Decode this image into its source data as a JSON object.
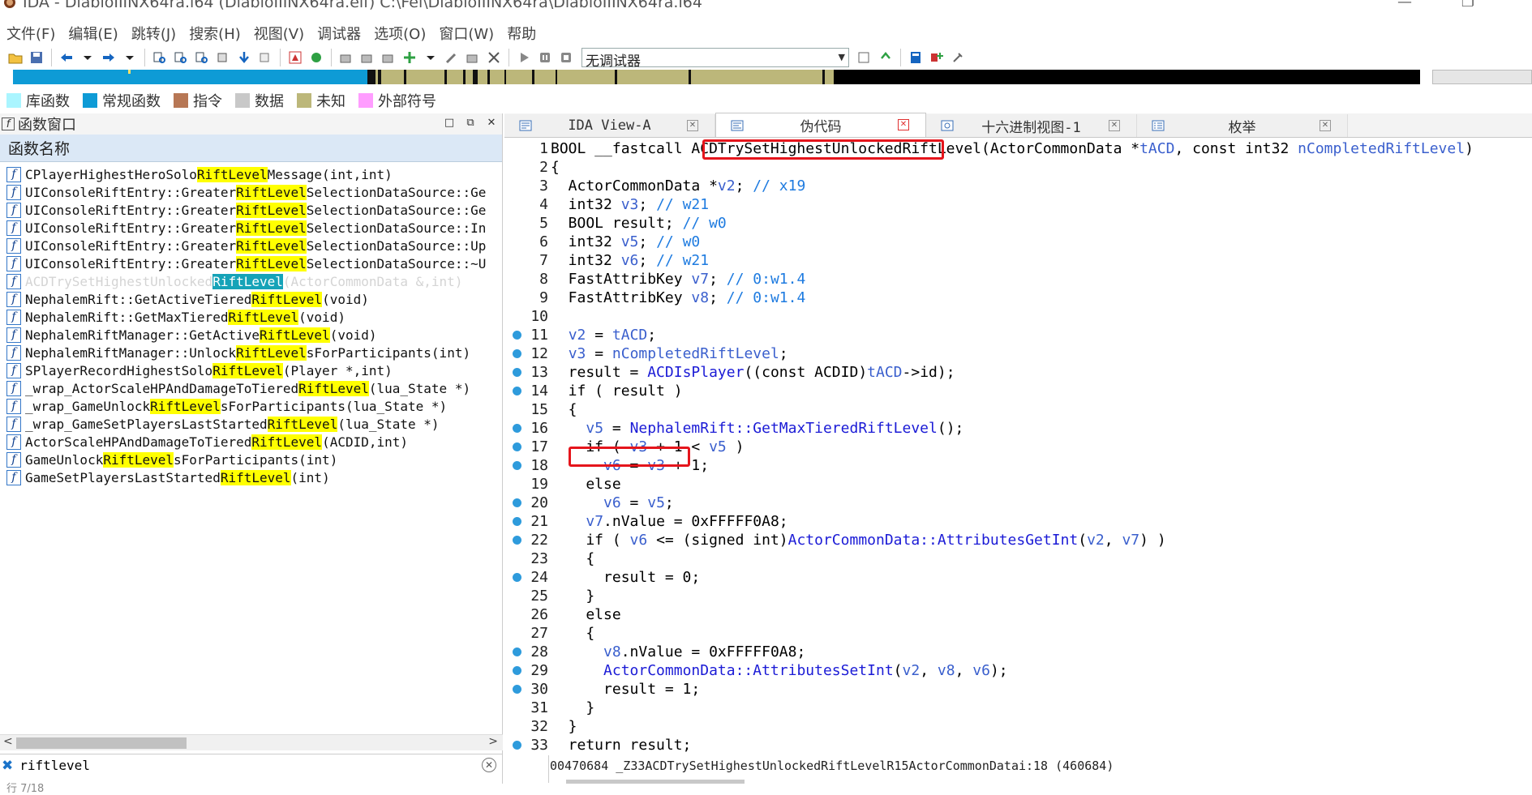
{
  "window": {
    "title": "IDA - DiabloIIINX64ra.i64 (DiabloIIINX64ra.elf) C:\\Fei\\DiabloIIINX64ra\\DiabloIIINX64ra.i64",
    "minimize": "—",
    "maximize": "❐",
    "close": "✕"
  },
  "menu": [
    "文件(F)",
    "编辑(E)",
    "跳转(J)",
    "搜索(H)",
    "视图(V)",
    "调试器",
    "选项(O)",
    "窗口(W)",
    "帮助"
  ],
  "toolbar": {
    "debugger_value": "无调试器"
  },
  "legend": [
    {
      "label": "库函数",
      "color": "#aaf5ff"
    },
    {
      "label": "常规函数",
      "color": "#0e9bd6"
    },
    {
      "label": "指令",
      "color": "#b77755"
    },
    {
      "label": "数据",
      "color": "#c8c8c8"
    },
    {
      "label": "未知",
      "color": "#bcb77a"
    },
    {
      "label": "外部符号",
      "color": "#ff9dff"
    }
  ],
  "func_panel": {
    "title": "函数窗口",
    "column_header": "函数名称",
    "functions": [
      {
        "pre": "CPlayerHighestHeroSolo",
        "hl": "RiftLevel",
        "post": "Message(int,int)"
      },
      {
        "pre": "UIConsoleRiftEntry::Greater",
        "hl": "RiftLevel",
        "post": "SelectionDataSource::Ge"
      },
      {
        "pre": "UIConsoleRiftEntry::Greater",
        "hl": "RiftLevel",
        "post": "SelectionDataSource::Ge"
      },
      {
        "pre": "UIConsoleRiftEntry::Greater",
        "hl": "RiftLevel",
        "post": "SelectionDataSource::In"
      },
      {
        "pre": "UIConsoleRiftEntry::Greater",
        "hl": "RiftLevel",
        "post": "SelectionDataSource::Up"
      },
      {
        "pre": "UIConsoleRiftEntry::Greater",
        "hl": "RiftLevel",
        "post": "SelectionDataSource::~U"
      },
      {
        "pre": "ACDTrySetHighestUnlocked",
        "hl": "RiftLevel",
        "post": "(ActorCommonData &,int)",
        "selected": true
      },
      {
        "pre": "NephalemRift::GetActiveTiered",
        "hl": "RiftLevel",
        "post": "(void)"
      },
      {
        "pre": "NephalemRift::GetMaxTiered",
        "hl": "RiftLevel",
        "post": "(void)"
      },
      {
        "pre": "NephalemRiftManager::GetActive",
        "hl": "RiftLevel",
        "post": "(void)"
      },
      {
        "pre": "NephalemRiftManager::Unlock",
        "hl": "RiftLevel",
        "post": "sForParticipants(int)"
      },
      {
        "pre": "SPlayerRecordHighestSolo",
        "hl": "RiftLevel",
        "post": "(Player *,int)"
      },
      {
        "pre": "_wrap_ActorScaleHPAndDamageToTiered",
        "hl": "RiftLevel",
        "post": "(lua_State *)"
      },
      {
        "pre": "_wrap_GameUnlock",
        "hl": "RiftLevel",
        "post": "sForParticipants(lua_State *)"
      },
      {
        "pre": "_wrap_GameSetPlayersLastStarted",
        "hl": "RiftLevel",
        "post": "(lua_State *)"
      },
      {
        "pre": "ActorScaleHPAndDamageToTiered",
        "hl": "RiftLevel",
        "post": "(ACDID,int)"
      },
      {
        "pre": "GameUnlock",
        "hl": "RiftLevel",
        "post": "sForParticipants(int)"
      },
      {
        "pre": "GameSetPlayersLastStarted",
        "hl": "RiftLevel",
        "post": "(int)"
      }
    ],
    "filter_value": "riftlevel",
    "filter_status": "行 7/18"
  },
  "tabs": [
    {
      "label": "IDA View-A",
      "active": false,
      "icon": "ida-view-icon"
    },
    {
      "label": "伪代码",
      "active": true,
      "icon": "pseudocode-icon"
    },
    {
      "label": "十六进制视图-1",
      "active": false,
      "icon": "hex-view-icon"
    },
    {
      "label": "枚举",
      "active": false,
      "icon": "enum-icon"
    }
  ],
  "code": [
    {
      "n": "1",
      "dot": false,
      "t": "BOOL __fastcall ACDTrySetHighestUnlockedRiftLevel(ActorCommonData *tACD, const int32 nCompletedRiftLevel)"
    },
    {
      "n": "2",
      "dot": false,
      "t": "{"
    },
    {
      "n": "3",
      "dot": false,
      "t": "  ActorCommonData *v2; // x19"
    },
    {
      "n": "4",
      "dot": false,
      "t": "  int32 v3; // w21"
    },
    {
      "n": "5",
      "dot": false,
      "t": "  BOOL result; // w0"
    },
    {
      "n": "6",
      "dot": false,
      "t": "  int32 v5; // w0"
    },
    {
      "n": "7",
      "dot": false,
      "t": "  int32 v6; // w21"
    },
    {
      "n": "8",
      "dot": false,
      "t": "  FastAttribKey v7; // 0:w1.4"
    },
    {
      "n": "9",
      "dot": false,
      "t": "  FastAttribKey v8; // 0:w1.4"
    },
    {
      "n": "10",
      "dot": false,
      "t": ""
    },
    {
      "n": "11",
      "dot": true,
      "t": "  v2 = tACD;"
    },
    {
      "n": "12",
      "dot": true,
      "t": "  v3 = nCompletedRiftLevel;"
    },
    {
      "n": "13",
      "dot": true,
      "t": "  result = ACDIsPlayer((const ACDID)tACD->id);"
    },
    {
      "n": "14",
      "dot": true,
      "t": "  if ( result )"
    },
    {
      "n": "15",
      "dot": false,
      "t": "  {"
    },
    {
      "n": "16",
      "dot": true,
      "t": "    v5 = NephalemRift::GetMaxTieredRiftLevel();"
    },
    {
      "n": "17",
      "dot": true,
      "t": "    if ( v3 + 1 < v5 )"
    },
    {
      "n": "18",
      "dot": true,
      "t": "      v6 = v3 + 1;"
    },
    {
      "n": "19",
      "dot": false,
      "t": "    else"
    },
    {
      "n": "20",
      "dot": true,
      "t": "      v6 = v5;"
    },
    {
      "n": "21",
      "dot": true,
      "t": "    v7.nValue = 0xFFFFF0A8;"
    },
    {
      "n": "22",
      "dot": true,
      "t": "    if ( v6 <= (signed int)ActorCommonData::AttributesGetInt(v2, v7) )"
    },
    {
      "n": "23",
      "dot": false,
      "t": "    {"
    },
    {
      "n": "24",
      "dot": true,
      "t": "      result = 0;"
    },
    {
      "n": "25",
      "dot": false,
      "t": "    }"
    },
    {
      "n": "26",
      "dot": false,
      "t": "    else"
    },
    {
      "n": "27",
      "dot": false,
      "t": "    {"
    },
    {
      "n": "28",
      "dot": true,
      "t": "      v8.nValue = 0xFFFFF0A8;"
    },
    {
      "n": "29",
      "dot": true,
      "t": "      ActorCommonData::AttributesSetInt(v2, v8, v6);"
    },
    {
      "n": "30",
      "dot": true,
      "t": "      result = 1;"
    },
    {
      "n": "31",
      "dot": false,
      "t": "    }"
    },
    {
      "n": "32",
      "dot": false,
      "t": "  }"
    },
    {
      "n": "33",
      "dot": true,
      "t": "  return result;"
    }
  ],
  "status_line": "00470684 _Z33ACDTrySetHighestUnlockedRiftLevelR15ActorCommonDatai:18 (460684)"
}
